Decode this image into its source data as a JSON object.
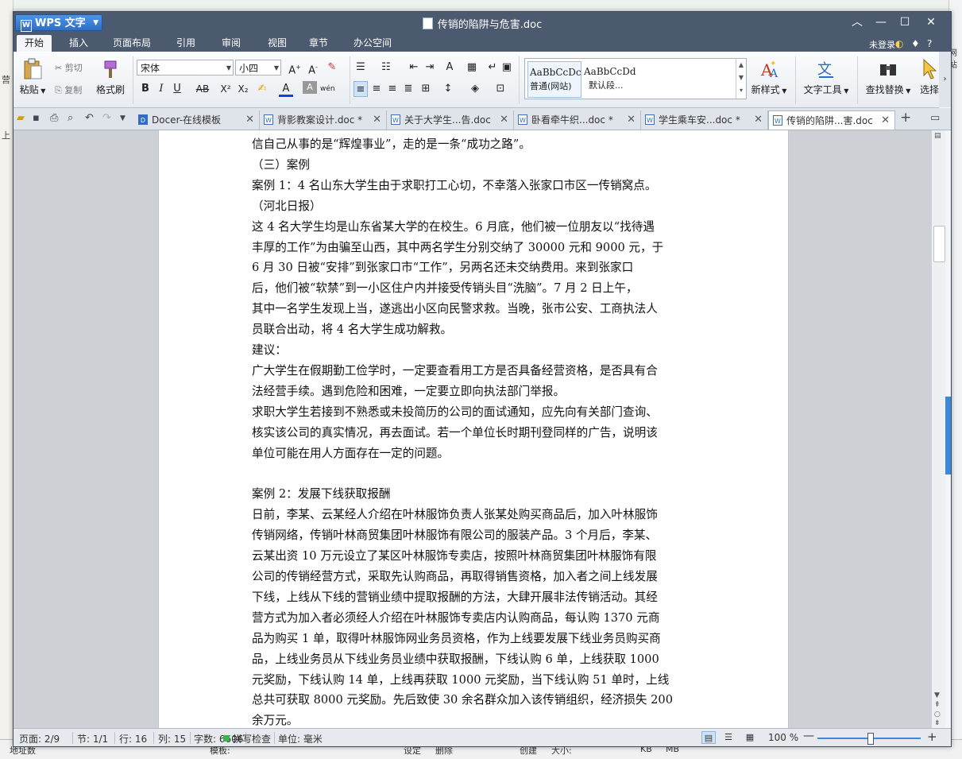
{
  "app": {
    "name": "WPS 文字",
    "window_title": "传销的陷阱与危害.doc",
    "login": "未登录",
    "help": "?"
  },
  "menu": [
    "开始",
    "插入",
    "页面布局",
    "引用",
    "审阅",
    "视图",
    "章节",
    "办公空间"
  ],
  "ribbon": {
    "paste": "粘贴",
    "cut": "剪切",
    "copy": "复制",
    "format_painter": "格式刷",
    "font_name": "宋体",
    "font_size": "小四",
    "styles": [
      {
        "preview": "AaBbCcDc",
        "name": "普通(网站)"
      },
      {
        "preview": "AaBbCcDd",
        "name": "默认段..."
      }
    ],
    "new_style": "新样式",
    "text_tools": "文字工具",
    "find_replace": "查找替换",
    "select": "选择"
  },
  "tabs": [
    {
      "label": "Docer-在线模板",
      "active": false
    },
    {
      "label": "背影教案设计.doc *",
      "active": false
    },
    {
      "label": "关于大学生...告.doc",
      "active": false
    },
    {
      "label": "卧看牵牛织...doc *",
      "active": false
    },
    {
      "label": "学生乘车安...doc *",
      "active": false
    },
    {
      "label": "传销的陷阱...害.doc",
      "active": true
    }
  ],
  "document": {
    "lines": [
      "信自己从事的是“辉煌事业”，走的是一条“成功之路”。",
      "（三）案例",
      "案例 1：4 名山东大学生由于求职打工心切，不幸落入张家口市区一传销窝点。",
      "（河北日报）",
      "这 4 名大学生均是山东省某大学的在校生。6 月底，他们被一位朋友以“找待遇",
      "丰厚的工作”为由骗至山西，其中两名学生分别交纳了 30000 元和 9000 元，于",
      "6 月 30 日被“安排”到张家口市“工作”，另两名还未交纳费用。来到张家口",
      "后，他们被“软禁”到一小区住户内并接受传销头目“洗脑”。7 月 2 日上午，",
      "其中一名学生发现上当，遂逃出小区向民警求救。当晚，张市公安、工商执法人",
      "员联合出动，将 4 名大学生成功解救。",
      "建议：",
      "广大学生在假期勤工俭学时，一定要查看用工方是否具备经营资格，是否具有合",
      "法经营手续。遇到危险和困难，一定要立即向执法部门举报。",
      "求职大学生若接到不熟悉或未投简历的公司的面试通知，应先向有关部门查询、",
      "核实该公司的真实情况，再去面试。若一个单位长时期刊登同样的广告，说明该",
      "单位可能在用人方面存在一定的问题。",
      "",
      "案例 2：发展下线获取报酬",
      "日前，李某、云某经人介绍在叶林服饰负责人张某处购买商品后，加入叶林服饰",
      "传销网络，传销叶林商贸集团叶林服饰有限公司的服装产品。3 个月后，李某、",
      "云某出资 10 万元设立了某区叶林服饰专卖店，按照叶林商贸集团叶林服饰有限",
      "公司的传销经营方式，采取先认购商品，再取得销售资格，加入者之间上线发展",
      "下线，上线从下线的营销业绩中提取报酬的方法，大肆开展非法传销活动。其经",
      "营方式为加入者必须经人介绍在叶林服饰专卖店内认购商品，每认购 1370 元商",
      "品为购买 1 单，取得叶林服饰网业务员资格，作为上线要发展下线业务员购买商",
      "品，上线业务员从下线业务员业绩中获取报酬，下线认购 6 单，上线获取 1000",
      "元奖励，下线认购 14 单，上线再获取 1000 元奖励，当下线认购 51 单时，上线",
      "总共可获取 8000 元奖励。先后致使 30 余名群众加入该传销组织，经济损失 200",
      "余万元。"
    ]
  },
  "status": {
    "page": "页面: 2/9",
    "section": "节: 1/1",
    "line": "行: 16",
    "col": "列: 15",
    "words": "字数: 6606",
    "spell": "拼写检查",
    "unit": "单位: 毫米",
    "zoom": "100 %"
  },
  "background": {
    "left_fragments": [
      "营",
      "上"
    ],
    "right_fragments": [
      "网站"
    ],
    "bottom_fragments": [
      "地址数",
      "模板:",
      "设定",
      "删除",
      "创建",
      "大小:",
      "KB",
      "MB"
    ]
  }
}
